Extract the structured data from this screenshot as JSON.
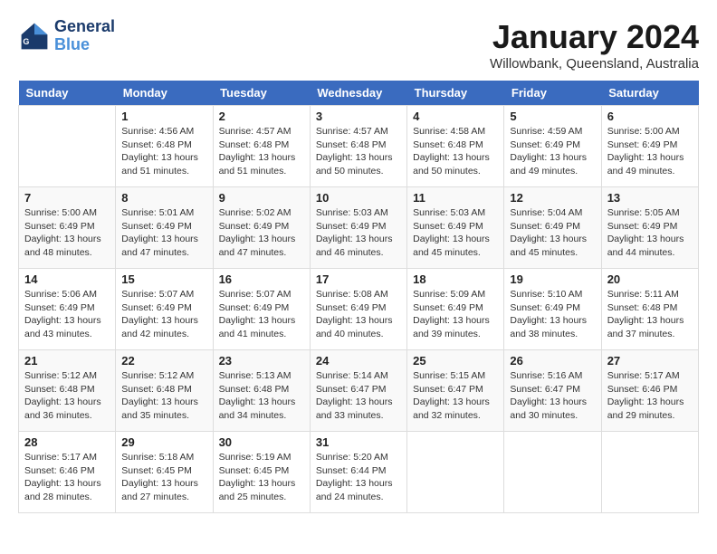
{
  "header": {
    "logo_line1": "General",
    "logo_line2": "Blue",
    "month": "January 2024",
    "location": "Willowbank, Queensland, Australia"
  },
  "days_of_week": [
    "Sunday",
    "Monday",
    "Tuesday",
    "Wednesday",
    "Thursday",
    "Friday",
    "Saturday"
  ],
  "weeks": [
    [
      {
        "day": "",
        "info": ""
      },
      {
        "day": "1",
        "info": "Sunrise: 4:56 AM\nSunset: 6:48 PM\nDaylight: 13 hours\nand 51 minutes."
      },
      {
        "day": "2",
        "info": "Sunrise: 4:57 AM\nSunset: 6:48 PM\nDaylight: 13 hours\nand 51 minutes."
      },
      {
        "day": "3",
        "info": "Sunrise: 4:57 AM\nSunset: 6:48 PM\nDaylight: 13 hours\nand 50 minutes."
      },
      {
        "day": "4",
        "info": "Sunrise: 4:58 AM\nSunset: 6:48 PM\nDaylight: 13 hours\nand 50 minutes."
      },
      {
        "day": "5",
        "info": "Sunrise: 4:59 AM\nSunset: 6:49 PM\nDaylight: 13 hours\nand 49 minutes."
      },
      {
        "day": "6",
        "info": "Sunrise: 5:00 AM\nSunset: 6:49 PM\nDaylight: 13 hours\nand 49 minutes."
      }
    ],
    [
      {
        "day": "7",
        "info": "Sunrise: 5:00 AM\nSunset: 6:49 PM\nDaylight: 13 hours\nand 48 minutes."
      },
      {
        "day": "8",
        "info": "Sunrise: 5:01 AM\nSunset: 6:49 PM\nDaylight: 13 hours\nand 47 minutes."
      },
      {
        "day": "9",
        "info": "Sunrise: 5:02 AM\nSunset: 6:49 PM\nDaylight: 13 hours\nand 47 minutes."
      },
      {
        "day": "10",
        "info": "Sunrise: 5:03 AM\nSunset: 6:49 PM\nDaylight: 13 hours\nand 46 minutes."
      },
      {
        "day": "11",
        "info": "Sunrise: 5:03 AM\nSunset: 6:49 PM\nDaylight: 13 hours\nand 45 minutes."
      },
      {
        "day": "12",
        "info": "Sunrise: 5:04 AM\nSunset: 6:49 PM\nDaylight: 13 hours\nand 45 minutes."
      },
      {
        "day": "13",
        "info": "Sunrise: 5:05 AM\nSunset: 6:49 PM\nDaylight: 13 hours\nand 44 minutes."
      }
    ],
    [
      {
        "day": "14",
        "info": "Sunrise: 5:06 AM\nSunset: 6:49 PM\nDaylight: 13 hours\nand 43 minutes."
      },
      {
        "day": "15",
        "info": "Sunrise: 5:07 AM\nSunset: 6:49 PM\nDaylight: 13 hours\nand 42 minutes."
      },
      {
        "day": "16",
        "info": "Sunrise: 5:07 AM\nSunset: 6:49 PM\nDaylight: 13 hours\nand 41 minutes."
      },
      {
        "day": "17",
        "info": "Sunrise: 5:08 AM\nSunset: 6:49 PM\nDaylight: 13 hours\nand 40 minutes."
      },
      {
        "day": "18",
        "info": "Sunrise: 5:09 AM\nSunset: 6:49 PM\nDaylight: 13 hours\nand 39 minutes."
      },
      {
        "day": "19",
        "info": "Sunrise: 5:10 AM\nSunset: 6:49 PM\nDaylight: 13 hours\nand 38 minutes."
      },
      {
        "day": "20",
        "info": "Sunrise: 5:11 AM\nSunset: 6:48 PM\nDaylight: 13 hours\nand 37 minutes."
      }
    ],
    [
      {
        "day": "21",
        "info": "Sunrise: 5:12 AM\nSunset: 6:48 PM\nDaylight: 13 hours\nand 36 minutes."
      },
      {
        "day": "22",
        "info": "Sunrise: 5:12 AM\nSunset: 6:48 PM\nDaylight: 13 hours\nand 35 minutes."
      },
      {
        "day": "23",
        "info": "Sunrise: 5:13 AM\nSunset: 6:48 PM\nDaylight: 13 hours\nand 34 minutes."
      },
      {
        "day": "24",
        "info": "Sunrise: 5:14 AM\nSunset: 6:47 PM\nDaylight: 13 hours\nand 33 minutes."
      },
      {
        "day": "25",
        "info": "Sunrise: 5:15 AM\nSunset: 6:47 PM\nDaylight: 13 hours\nand 32 minutes."
      },
      {
        "day": "26",
        "info": "Sunrise: 5:16 AM\nSunset: 6:47 PM\nDaylight: 13 hours\nand 30 minutes."
      },
      {
        "day": "27",
        "info": "Sunrise: 5:17 AM\nSunset: 6:46 PM\nDaylight: 13 hours\nand 29 minutes."
      }
    ],
    [
      {
        "day": "28",
        "info": "Sunrise: 5:17 AM\nSunset: 6:46 PM\nDaylight: 13 hours\nand 28 minutes."
      },
      {
        "day": "29",
        "info": "Sunrise: 5:18 AM\nSunset: 6:45 PM\nDaylight: 13 hours\nand 27 minutes."
      },
      {
        "day": "30",
        "info": "Sunrise: 5:19 AM\nSunset: 6:45 PM\nDaylight: 13 hours\nand 25 minutes."
      },
      {
        "day": "31",
        "info": "Sunrise: 5:20 AM\nSunset: 6:44 PM\nDaylight: 13 hours\nand 24 minutes."
      },
      {
        "day": "",
        "info": ""
      },
      {
        "day": "",
        "info": ""
      },
      {
        "day": "",
        "info": ""
      }
    ]
  ]
}
